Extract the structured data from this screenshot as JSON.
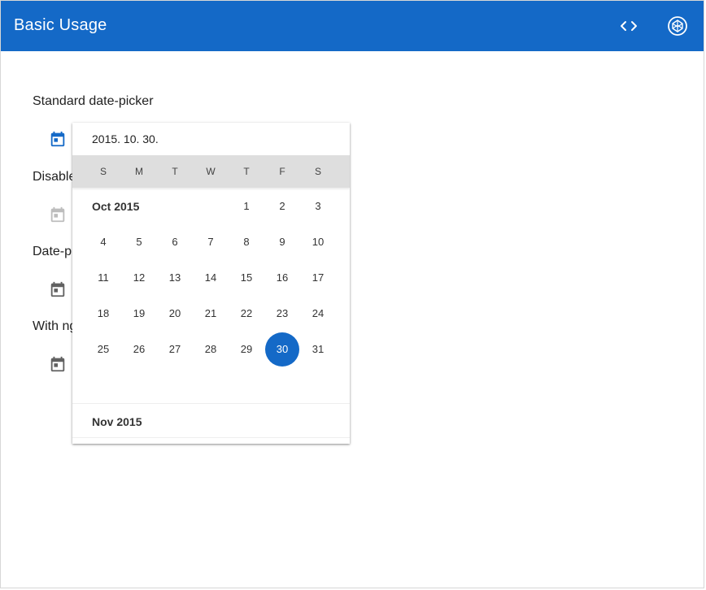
{
  "toolbar": {
    "title": "Basic Usage",
    "code_icon": "code-brackets-icon",
    "codepen_icon": "codepen-icon",
    "bg_color": "#1469c7"
  },
  "sections": [
    {
      "label": "Standard date-picker",
      "icon": "calendar-icon",
      "icon_color": "#1469c7"
    },
    {
      "label": "Disable",
      "icon": "calendar-icon",
      "icon_color": "#bdbdbd"
    },
    {
      "label": "Date-p",
      "icon": "calendar-icon",
      "icon_color": "#616161"
    },
    {
      "label": "With ng",
      "icon": "calendar-icon",
      "icon_color": "#616161"
    }
  ],
  "picker": {
    "input_value": "2015. 10. 30.",
    "weekdays": [
      "S",
      "M",
      "T",
      "W",
      "T",
      "F",
      "S"
    ],
    "months": [
      {
        "label": "Oct 2015",
        "weeks": [
          [
            "",
            "",
            "",
            "",
            "1",
            "2",
            "3"
          ],
          [
            "4",
            "5",
            "6",
            "7",
            "8",
            "9",
            "10"
          ],
          [
            "11",
            "12",
            "13",
            "14",
            "15",
            "16",
            "17"
          ],
          [
            "18",
            "19",
            "20",
            "21",
            "22",
            "23",
            "24"
          ],
          [
            "25",
            "26",
            "27",
            "28",
            "29",
            "30",
            "31"
          ]
        ]
      },
      {
        "label": "Nov 2015",
        "weeks": []
      }
    ],
    "selected_day": "30",
    "selected_color": "#1469c7"
  }
}
